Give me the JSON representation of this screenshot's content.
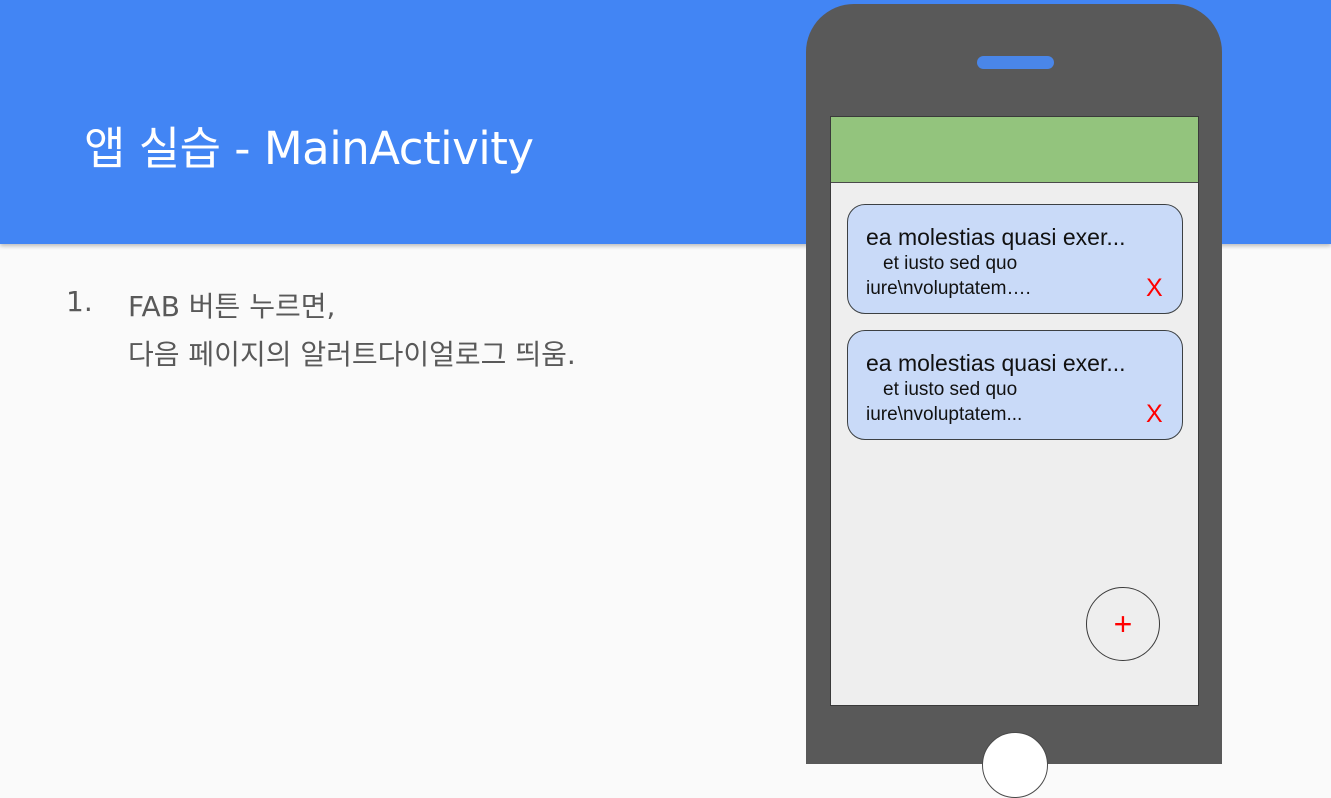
{
  "slide": {
    "title": "앱 실습 - MainActivity",
    "steps": [
      {
        "number": "1.",
        "lines": [
          "FAB 버튼 누르면,",
          "다음 페이지의 알러트다이얼로그 띄움."
        ]
      }
    ]
  },
  "phone": {
    "cards": [
      {
        "title": "ea molestias quasi exer...",
        "subtitle": "et iusto sed quo",
        "body": "iure\\nvoluptatem….",
        "delete_label": "X"
      },
      {
        "title": "ea molestias quasi exer...",
        "subtitle": "et iusto sed quo",
        "body": "iure\\nvoluptatem...",
        "delete_label": "X"
      }
    ],
    "fab_label": "+"
  },
  "colors": {
    "header": "#4285f4",
    "app_bar": "#93c47d",
    "card_background": "#c9daf8",
    "delete_accent": "#ff0000",
    "phone_frame": "#595959"
  }
}
